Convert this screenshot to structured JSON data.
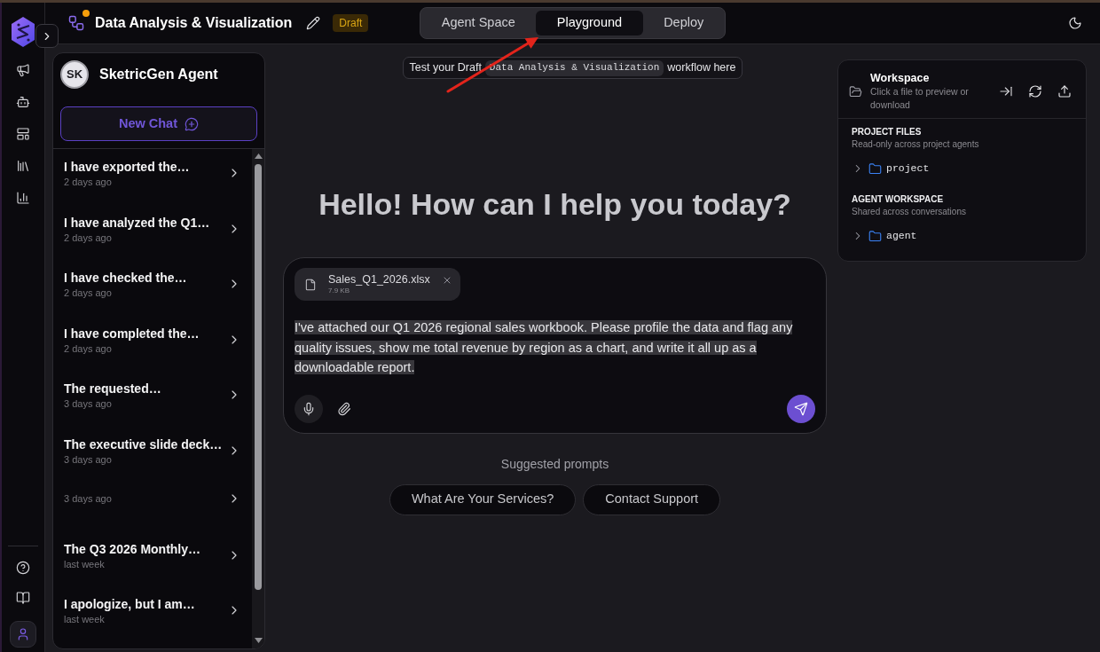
{
  "header": {
    "title": "Data Analysis & Visualization",
    "badge": "Draft"
  },
  "tabs": [
    {
      "label": "Agent Space",
      "selected": false
    },
    {
      "label": "Playground",
      "selected": true
    },
    {
      "label": "Deploy",
      "selected": false
    }
  ],
  "agent_panel": {
    "initials": "SK",
    "name": "SketricGen Agent",
    "new_chat": "New Chat",
    "chats": [
      {
        "title": "I have exported the…",
        "time": "2 days ago"
      },
      {
        "title": "I have analyzed the Q1…",
        "time": "2 days ago"
      },
      {
        "title": "I have checked the…",
        "time": "2 days ago"
      },
      {
        "title": "I have completed the…",
        "time": "2 days ago"
      },
      {
        "title": "The requested…",
        "time": "3 days ago"
      },
      {
        "title": "The executive slide deck…",
        "time": "3 days ago"
      },
      {
        "time": "3 days ago"
      },
      {
        "title": "The Q3 2026 Monthly…",
        "time": "last week"
      },
      {
        "title": "I apologize, but I am…",
        "time": "last week"
      }
    ]
  },
  "banner": {
    "prefix": "Test your Draft",
    "workflow": "Data Analysis & Visualization",
    "suffix": "workflow here"
  },
  "greeting": "Hello! How can I help you today?",
  "composer": {
    "attachment": {
      "name": "Sales_Q1_2026.xlsx",
      "size": "7.9 KB"
    },
    "value": "I've attached our Q1 2026 regional sales workbook. Please profile the data and flag any quality issues, show me total revenue by region as a chart, and write it all up as a downloadable report."
  },
  "suggested_prompts": {
    "heading": "Suggested prompts",
    "prompts": [
      "What Are Your Services?",
      "Contact Support"
    ]
  },
  "workspace": {
    "title": "Workspace",
    "subtitle": "Click a file to preview or download",
    "sections": [
      {
        "heading": "PROJECT FILES",
        "description": "Read-only across project agents",
        "folders": [
          {
            "name": "project",
            "expanded": false
          }
        ]
      },
      {
        "heading": "AGENT WORKSPACE",
        "description": "Shared across conversations",
        "folders": [
          {
            "name": "agent",
            "expanded": false
          }
        ]
      }
    ]
  }
}
